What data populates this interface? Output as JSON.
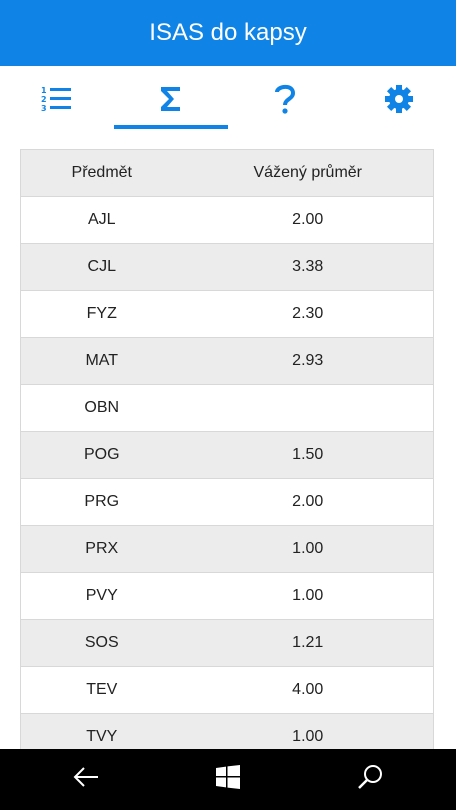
{
  "app": {
    "title": "ISAS do kapsy"
  },
  "tabs": [
    {
      "id": "list",
      "icon": "numbered-list-icon"
    },
    {
      "id": "sum",
      "icon": "sigma-icon",
      "active": true
    },
    {
      "id": "help",
      "icon": "question-mark-icon"
    },
    {
      "id": "settings",
      "icon": "gear-icon"
    }
  ],
  "accent_color": "#0f84e6",
  "table": {
    "headers": [
      "Předmět",
      "Vážený průměr"
    ],
    "rows": [
      [
        "AJL",
        "2.00"
      ],
      [
        "CJL",
        "3.38"
      ],
      [
        "FYZ",
        "2.30"
      ],
      [
        "MAT",
        "2.93"
      ],
      [
        "OBN",
        ""
      ],
      [
        "POG",
        "1.50"
      ],
      [
        "PRG",
        "2.00"
      ],
      [
        "PRX",
        "1.00"
      ],
      [
        "PVY",
        "1.00"
      ],
      [
        "SOS",
        "1.21"
      ],
      [
        "TEV",
        "4.00"
      ],
      [
        "TVY",
        "1.00"
      ]
    ]
  },
  "navbar": [
    "back-arrow-icon",
    "windows-start-icon",
    "search-icon"
  ]
}
